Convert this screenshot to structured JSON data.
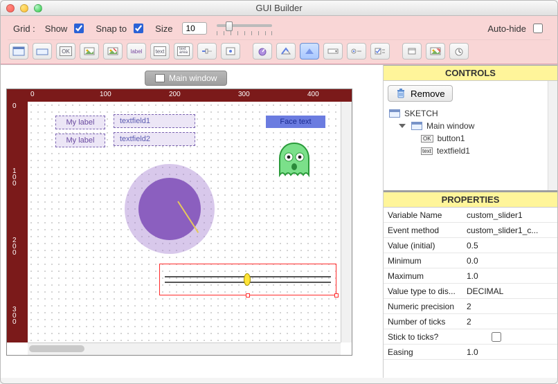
{
  "window": {
    "title": "GUI Builder"
  },
  "topbar": {
    "grid_label": "Grid :",
    "show_label": "Show",
    "show_checked": true,
    "snap_label": "Snap to",
    "snap_checked": true,
    "size_label": "Size",
    "size_value": "10",
    "autohide_label": "Auto-hide",
    "autohide_checked": false
  },
  "toolbar_icons": [
    "window",
    "panel",
    "ok-button",
    "image-button",
    "img-toggle",
    "label",
    "text",
    "textarea",
    "slider",
    "slider-2d",
    "knob",
    "drop",
    "progress",
    "stick",
    "option",
    "checkbox",
    "timer",
    "image",
    "clock"
  ],
  "main_tab": {
    "label": "Main window"
  },
  "ruler": {
    "h_ticks": [
      "0",
      "100",
      "200",
      "300",
      "400"
    ],
    "v_ticks": [
      "0",
      "100",
      "200",
      "300"
    ]
  },
  "canvas_widgets": {
    "label1": "My label",
    "label2": "My label",
    "textfield1": "textfield1",
    "textfield2": "textfield2",
    "face_button": "Face text"
  },
  "controls_panel": {
    "title": "CONTROLS",
    "remove_label": "Remove",
    "tree": {
      "root": "SKETCH",
      "win": "Main window",
      "items": [
        "button1",
        "textfield1"
      ]
    }
  },
  "properties_panel": {
    "title": "PROPERTIES",
    "rows": [
      {
        "k": "Variable Name",
        "v": "custom_slider1"
      },
      {
        "k": "Event method",
        "v": "custom_slider1_c..."
      },
      {
        "k": "Value (initial)",
        "v": "0.5"
      },
      {
        "k": "Minimum",
        "v": "0.0"
      },
      {
        "k": "Maximum",
        "v": "1.0"
      },
      {
        "k": "Value type to dis...",
        "v": "DECIMAL"
      },
      {
        "k": "Numeric precision",
        "v": "2"
      },
      {
        "k": "Number of ticks",
        "v": "2"
      },
      {
        "k": "Stick to ticks?",
        "v": "__checkbox__"
      },
      {
        "k": "Easing",
        "v": "1.0"
      }
    ]
  }
}
